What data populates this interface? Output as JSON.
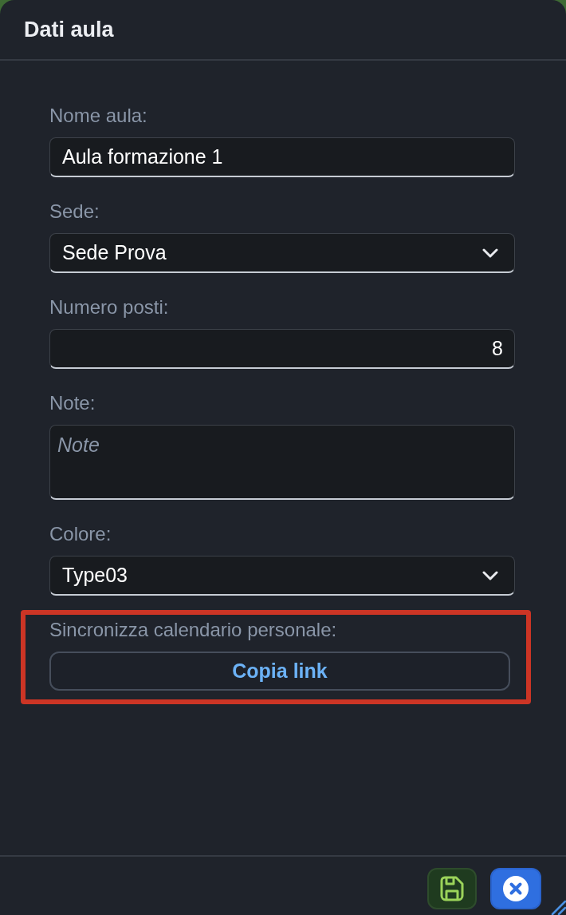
{
  "dialog": {
    "title": "Dati aula"
  },
  "fields": [
    {
      "kind": "text",
      "label": "Nome aula:",
      "value": "Aula formazione 1"
    },
    {
      "kind": "select",
      "label": "Sede:",
      "value": "Sede Prova"
    },
    {
      "kind": "number",
      "label": "Numero posti:",
      "value": "8"
    },
    {
      "kind": "textarea",
      "label": "Note:",
      "placeholder": "Note"
    },
    {
      "kind": "select",
      "label": "Colore:",
      "value": "Type03"
    }
  ],
  "calendar_sync": {
    "label": "Sincronizza calendario personale:",
    "button": "Copia link",
    "highlighted": true
  },
  "footer": {
    "buttons": [
      {
        "kind": "save"
      },
      {
        "kind": "close"
      }
    ]
  }
}
